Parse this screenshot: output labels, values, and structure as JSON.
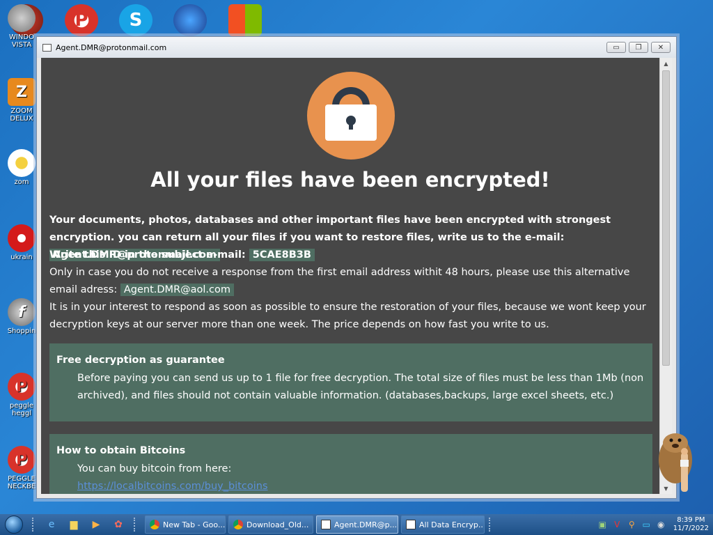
{
  "desktop": {
    "icons": [
      {
        "label": "WINDO\nVISTA",
        "icon": "vista-icon"
      },
      {
        "label": "ZOOM\nDELUX",
        "icon": "zoom-deluxe-icon"
      },
      {
        "label": "zom",
        "icon": "flower-icon"
      },
      {
        "label": "ukrain",
        "icon": "radiation-icon"
      },
      {
        "label": "Shoppin",
        "icon": "flash-icon"
      },
      {
        "label": "peggle\nheggl",
        "icon": "peggle-icon"
      },
      {
        "label": "PEGGLE\nNECKBE",
        "icon": "peggle-icon"
      }
    ],
    "top_icons": [
      "vista-orb-icon",
      "peggle-p-icon",
      "skype-icon",
      "globe-icon",
      "windows-flag-icon"
    ]
  },
  "window": {
    "title": "Agent.DMR@protonmail.com",
    "buttons": {
      "minimize": "▭",
      "restore": "❐",
      "close": "✕"
    }
  },
  "ransom": {
    "headline": "All your files have been encrypted!",
    "p1_text": "Your documents, photos, databases and other important files have been encrypted with strongest encryption. you can return all your files if you want to restore files, write us to the e-mail:",
    "email_primary": "Agent.DMR@protonmail.com",
    "id_label": "Write this ID in the subject e-mail:",
    "id_value": "5CAE8B3B",
    "alt_text": "Only in case you do not receive a response from the first email address withit 48 hours, please use this alternative email adress:",
    "email_alt": "Agent.DMR@aol.com",
    "interest_text": "It is in your interest to respond as soon as possible to ensure the restoration of your files, because we wont keep your decryption keys at our server more than one week. The price depends on how fast you write to us.",
    "panel1": {
      "title": "Free decryption as guarantee",
      "body": "Before paying you can send us up to 1 file for free decryption. The total size of files must be less than 1Mb (non archived), and files should not contain valuable information. (databases,backups, large excel sheets, etc.)"
    },
    "panel2": {
      "title": "How to obtain Bitcoins",
      "body": "You can buy bitcoin from here:",
      "link": "https://localbitcoins.com/buy_bitcoins"
    }
  },
  "taskbar": {
    "tasks": [
      {
        "label": "New Tab - Goo...",
        "icon": "chrome-icon",
        "active": false
      },
      {
        "label": "Download_Old...",
        "icon": "chrome-icon",
        "active": false
      },
      {
        "label": "Agent.DMR@p...",
        "icon": "window-icon",
        "active": true
      },
      {
        "label": "All Data Encryp...",
        "icon": "window-icon",
        "active": false
      }
    ],
    "clock_time": "8:39 PM",
    "clock_date": "11/7/2022"
  },
  "colors": {
    "content_bg": "#474747",
    "highlight_green": "#4f6e62",
    "lock_orange": "#e8924e",
    "lock_dark": "#2d3a49",
    "link_blue": "#5b8fd9"
  }
}
